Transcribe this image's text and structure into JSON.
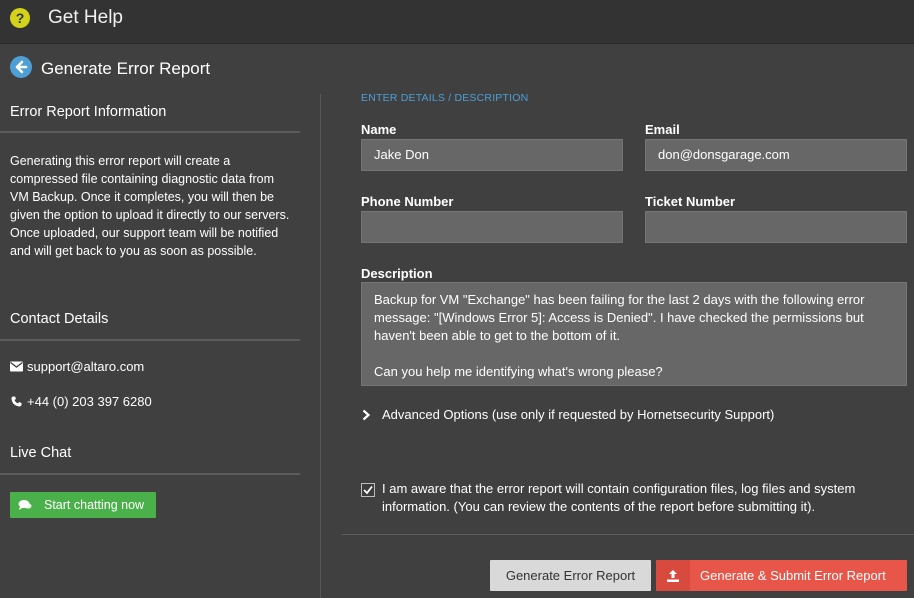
{
  "app": {
    "title": "Get Help",
    "help_icon_glyph": "?"
  },
  "page": {
    "title": "Generate Error Report"
  },
  "sidebar": {
    "info_heading": "Error Report Information",
    "info_text": "Generating this error report will create a compressed file containing diagnostic data from VM Backup. Once it completes, you will then be given the option to upload it directly to our servers. Once uploaded, our support team will be notified and will get back to you as soon as possible.",
    "contact_heading": "Contact Details",
    "email": "support@altaro.com",
    "phone": "+44 (0) 203 397 6280",
    "chat_heading": "Live Chat",
    "chat_button": "Start chatting now"
  },
  "form": {
    "section_tag": "ENTER DETAILS / DESCRIPTION",
    "name_label": "Name",
    "name_value": "Jake Don",
    "email_label": "Email",
    "email_value": "don@donsgarage.com",
    "phone_label": "Phone Number",
    "phone_value": "",
    "ticket_label": "Ticket Number",
    "ticket_value": "",
    "description_label": "Description",
    "description_line1": "Backup for VM \"Exchange\" has been failing for the last 2 days with the following error message: \"[Windows Error 5]: Access is Denied\". I have checked the permissions but haven't been able to get to the bottom of it.",
    "description_line2": "Can you help me identifying what's wrong please?",
    "advanced_options": "Advanced Options (use only if requested by Hornetsecurity Support)",
    "acknowledge_checked": true,
    "acknowledge_text": "I am aware that the error report will contain configuration files, log files and system information. (You can review the contents of the report before submitting it)."
  },
  "actions": {
    "generate": "Generate Error Report",
    "generate_submit": "Generate & Submit Error Report"
  },
  "colors": {
    "accent_blue": "#4d9fd6",
    "help_yellow": "#d4d31c",
    "chat_green": "#4ab04a",
    "submit_red": "#e8564a"
  }
}
